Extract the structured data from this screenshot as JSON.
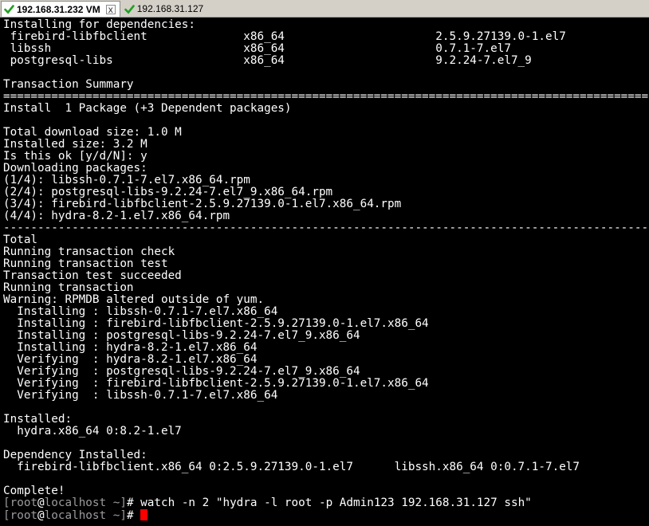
{
  "tabs": [
    {
      "label": "192.168.31.232 VM",
      "active": true,
      "close": "x"
    },
    {
      "label": "192.168.31.127",
      "active": false
    }
  ],
  "colors": {
    "check": "#22a022",
    "cursor": "#ff0000",
    "prompt": "#9b9b9b"
  },
  "terminal": {
    "lines": [
      "Installing for dependencies:",
      " firebird-libfbclient              x86_64                      2.5.9.27139.0-1.el7",
      " libssh                            x86_64                      0.7.1-7.el7",
      " postgresql-libs                   x86_64                      9.2.24-7.el7_9",
      "",
      "Transaction Summary",
      "==============================================================================================",
      "Install  1 Package (+3 Dependent packages)",
      "",
      "Total download size: 1.0 M",
      "Installed size: 3.2 M",
      "Is this ok [y/d/N]: y",
      "Downloading packages:",
      "(1/4): libssh-0.7.1-7.el7.x86_64.rpm",
      "(2/4): postgresql-libs-9.2.24-7.el7_9.x86_64.rpm",
      "(3/4): firebird-libfbclient-2.5.9.27139.0-1.el7.x86_64.rpm",
      "(4/4): hydra-8.2-1.el7.x86_64.rpm",
      "----------------------------------------------------------------------------------------------",
      "Total",
      "Running transaction check",
      "Running transaction test",
      "Transaction test succeeded",
      "Running transaction",
      "Warning: RPMDB altered outside of yum.",
      "  Installing : libssh-0.7.1-7.el7.x86_64",
      "  Installing : firebird-libfbclient-2.5.9.27139.0-1.el7.x86_64",
      "  Installing : postgresql-libs-9.2.24-7.el7_9.x86_64",
      "  Installing : hydra-8.2-1.el7.x86_64",
      "  Verifying  : hydra-8.2-1.el7.x86_64",
      "  Verifying  : postgresql-libs-9.2.24-7.el7_9.x86_64",
      "  Verifying  : firebird-libfbclient-2.5.9.27139.0-1.el7.x86_64",
      "  Verifying  : libssh-0.7.1-7.el7.x86_64",
      "",
      "Installed:",
      "  hydra.x86_64 0:8.2-1.el7",
      "",
      "Dependency Installed:",
      "  firebird-libfbclient.x86_64 0:2.5.9.27139.0-1.el7      libssh.x86_64 0:0.7.1-7.el7",
      "",
      "Complete!"
    ],
    "prompt1": {
      "open": "[",
      "user": "root",
      "at": "@",
      "host": "localhost",
      "path": " ~",
      "close": "]",
      "sym": "#",
      "command": " watch -n 2 \"hydra -l root -p Admin123 192.168.31.127 ssh\""
    },
    "prompt2": {
      "open": "[",
      "user": "root",
      "at": "@",
      "host": "localhost",
      "path": " ~",
      "close": "]",
      "sym": "#",
      "command": " "
    }
  }
}
